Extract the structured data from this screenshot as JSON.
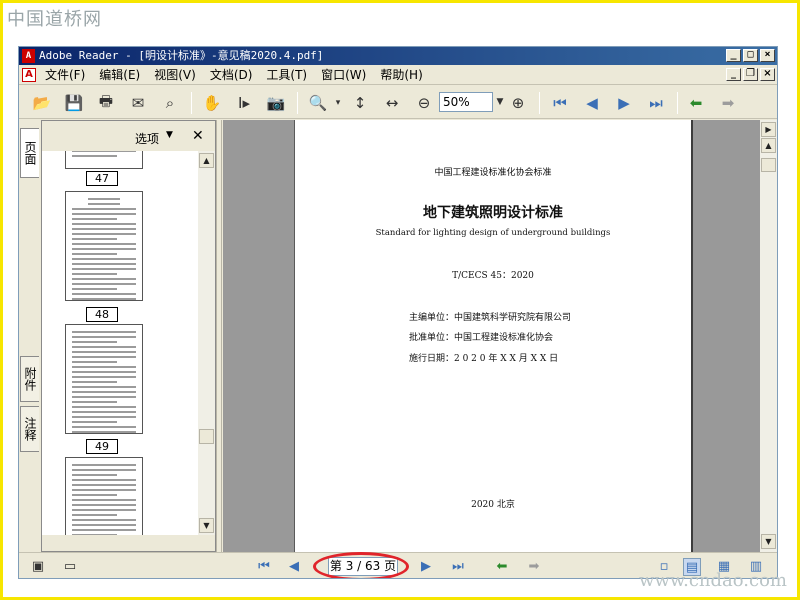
{
  "watermark": {
    "top": "中国道桥网",
    "bottom": "www.cndao.com"
  },
  "window": {
    "title": "Adobe Reader - [明设计标准》-意见稿2020.4.pdf]"
  },
  "menu": {
    "items": [
      "文件(F)",
      "编辑(E)",
      "视图(V)",
      "文档(D)",
      "工具(T)",
      "窗口(W)",
      "帮助(H)"
    ]
  },
  "toolbar": {
    "zoom": "50%"
  },
  "left_tabs": {
    "pages": "页面",
    "attachments": "附件",
    "comments": "注释"
  },
  "nav_panel": {
    "options": "选项",
    "thumbnail_pages": [
      "47",
      "48",
      "49"
    ]
  },
  "document": {
    "org_header": "中国工程建设标准化协会标准",
    "title": "地下建筑照明设计标准",
    "subtitle": "Standard for lighting design of underground buildings",
    "code": "T/CECS 45：2020",
    "editor": "主编单位：中国建筑科学研究院有限公司",
    "approver": "批准单位：中国工程建设标准化协会",
    "effective": "施行日期：2 0 2 0 年 X X 月 X X 日",
    "footer": "2020   北京"
  },
  "status": {
    "page_indicator": "第 3 / 63 页"
  }
}
